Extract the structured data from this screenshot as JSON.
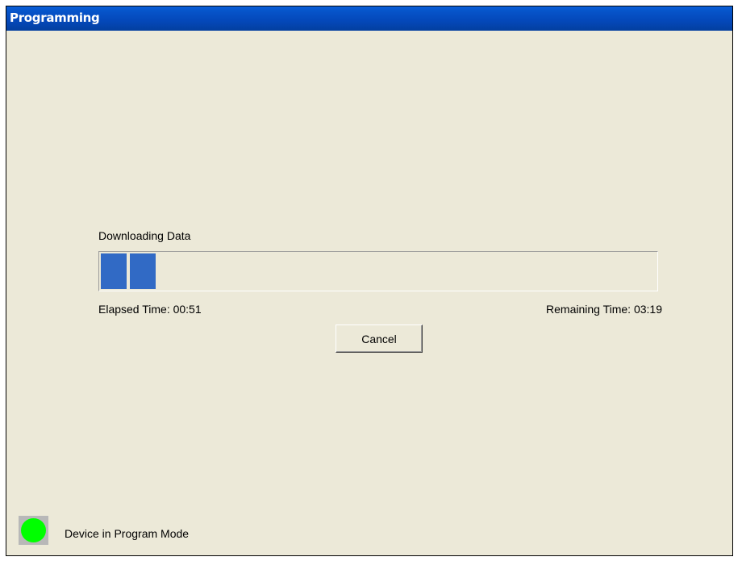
{
  "window": {
    "title": "Programming"
  },
  "progress": {
    "label": "Downloading Data",
    "fraction": 0.1,
    "fill_color": "#316ac5",
    "elapsed_text": "Elapsed Time: 00:51",
    "remaining_text": "Remaining Time: 03:19"
  },
  "buttons": {
    "cancel_label": "Cancel"
  },
  "status": {
    "indicator_color": "#00ff00",
    "indicator_icon": "status-led-icon",
    "mode_text": "Device in Program Mode"
  }
}
